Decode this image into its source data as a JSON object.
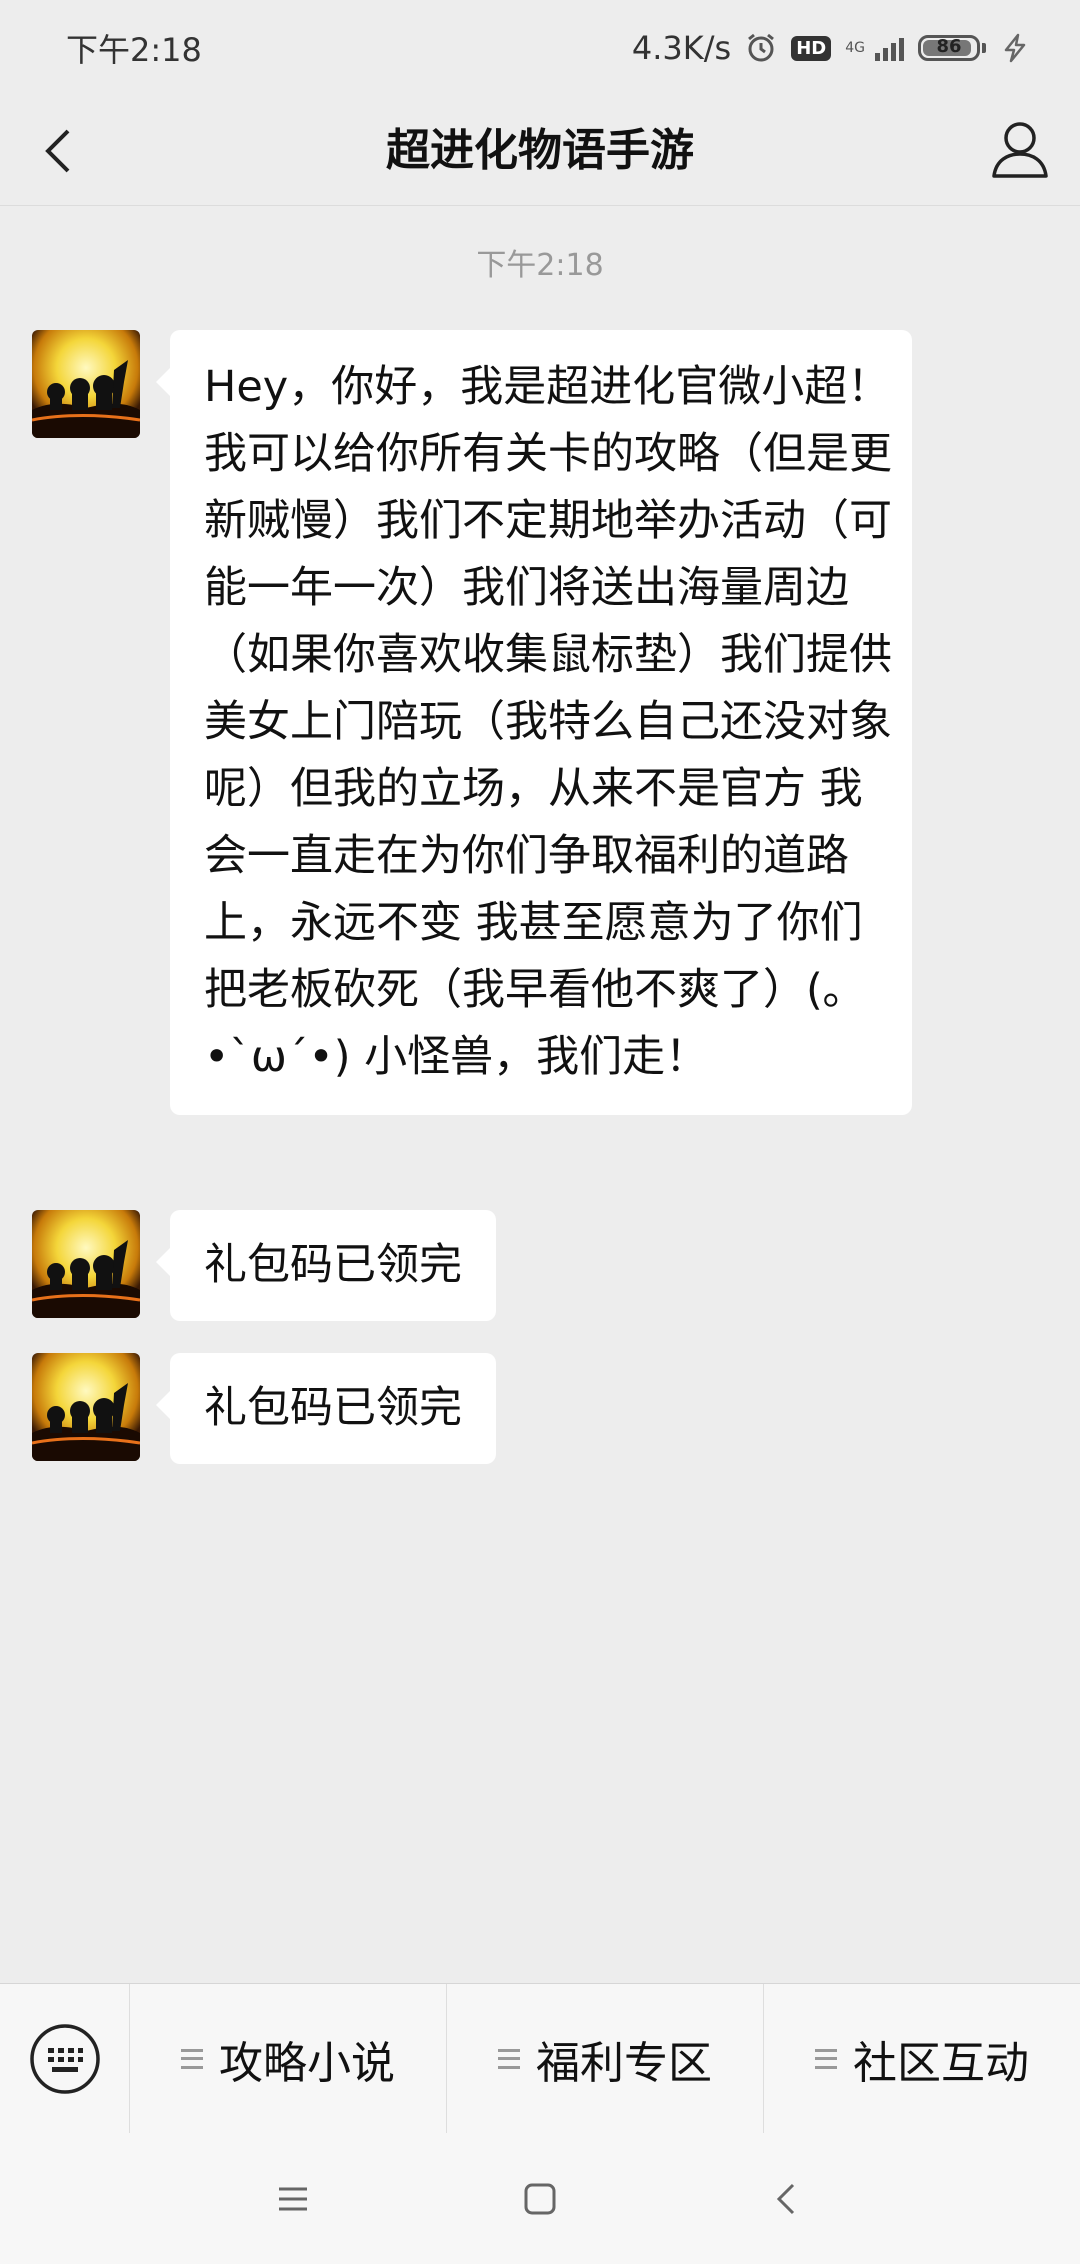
{
  "status_bar": {
    "time": "下午2:18",
    "net_speed": "4.3K/s",
    "hd_label": "HD",
    "network_type": "4G",
    "battery_level": "86"
  },
  "nav": {
    "title": "超进化物语手游"
  },
  "chat": {
    "timestamp": "下午2:18",
    "messages": [
      {
        "sender": "received",
        "text": "Hey，你好，我是超进化官微小超！我可以给你所有关卡的攻略（但是更新贼慢）我们不定期地举办活动（可能一年一次）我们将送出海量周边（如果你喜欢收集鼠标垫）我们提供美女上门陪玩（我特么自己还没对象呢）但我的立场，从来不是官方 我会一直走在为你们争取福利的道路上，永远不变 我甚至愿意为了你们把老板砍死（我早看他不爽了）(｡•ˋωˊ•) 小怪兽，我们走！"
      },
      {
        "sender": "received",
        "text": "礼包码已领完"
      },
      {
        "sender": "received",
        "text": "礼包码已领完"
      }
    ]
  },
  "bottom_menu": {
    "items": [
      {
        "label": "攻略小说"
      },
      {
        "label": "福利专区"
      },
      {
        "label": "社区互动"
      }
    ]
  },
  "icons": {
    "back": "chevron-left-icon",
    "profile": "person-icon",
    "keyboard": "keyboard-icon",
    "menu": "menu-lines-icon",
    "recent": "recents-icon",
    "home": "home-icon",
    "back_sys": "back-icon"
  }
}
